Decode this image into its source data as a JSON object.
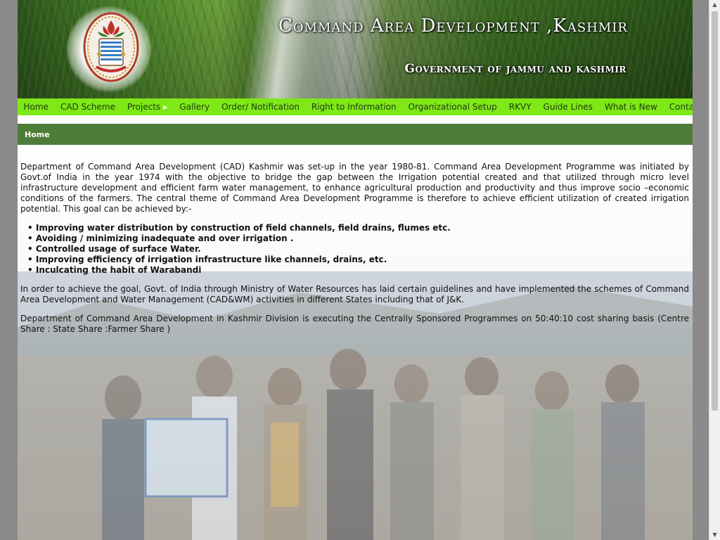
{
  "header": {
    "title": "Command Area Development ,Kashmir",
    "subtitle": "Government of jammu and kashmir"
  },
  "nav": {
    "items": [
      {
        "label": "Home"
      },
      {
        "label": "CAD Scheme"
      },
      {
        "label": "Projects",
        "has_submenu": true
      },
      {
        "label": "Gallery"
      },
      {
        "label": "Order/ Notification"
      },
      {
        "label": "Right to Information"
      },
      {
        "label": "Organizational Setup"
      },
      {
        "label": "RKVY"
      },
      {
        "label": "Guide Lines"
      },
      {
        "label": "What is New"
      },
      {
        "label": "Contacts"
      }
    ]
  },
  "breadcrumb": {
    "label": "Home"
  },
  "content": {
    "intro": "Department of Command Area Development (CAD) Kashmir was set-up in the year 1980-81. Command Area Development Programme was initiated by Govt.of India in the year 1974 with the objective to bridge the gap between the Irrigation potential created and that utilized through micro level infrastructure development and efficient farm water management, to enhance agricultural production and productivity and thus improve socio –economic conditions of the farmers. The central theme of Command Area Development Programme is therefore to achieve efficient utilization of created irrigation potential. This goal can be achieved by:-",
    "bullets": [
      "Improving water distribution by construction of field channels, field drains, flumes etc.",
      "Avoiding / minimizing inadequate and over irrigation .",
      "Controlled usage of surface Water.",
      "Improving efficiency of irrigation infrastructure like channels, drains, etc.",
      "Inculcating the habit of Warabandi"
    ],
    "paragraph2": "In order to achieve the goal, Govt. of India through Ministry of Water Resources has laid certain guidelines and have implemented the schemes of Command Area Development and Water Management (CAD&WM) activities in different States including that of J&K.",
    "paragraph3": "Department of Command Area Development in Kashmir Division is executing the Centrally Sponsored Programmes on 50:40:10 cost sharing basis (Centre Share : State Share :Farmer Share )"
  },
  "colors": {
    "nav_bg": "#7fe816",
    "breadcrumb_bg": "#4e7d3a",
    "page_bg": "#8a8a8a"
  },
  "icons": {
    "emblem": "jk-emblem-icon",
    "submenu": "triangle-right-icon"
  }
}
